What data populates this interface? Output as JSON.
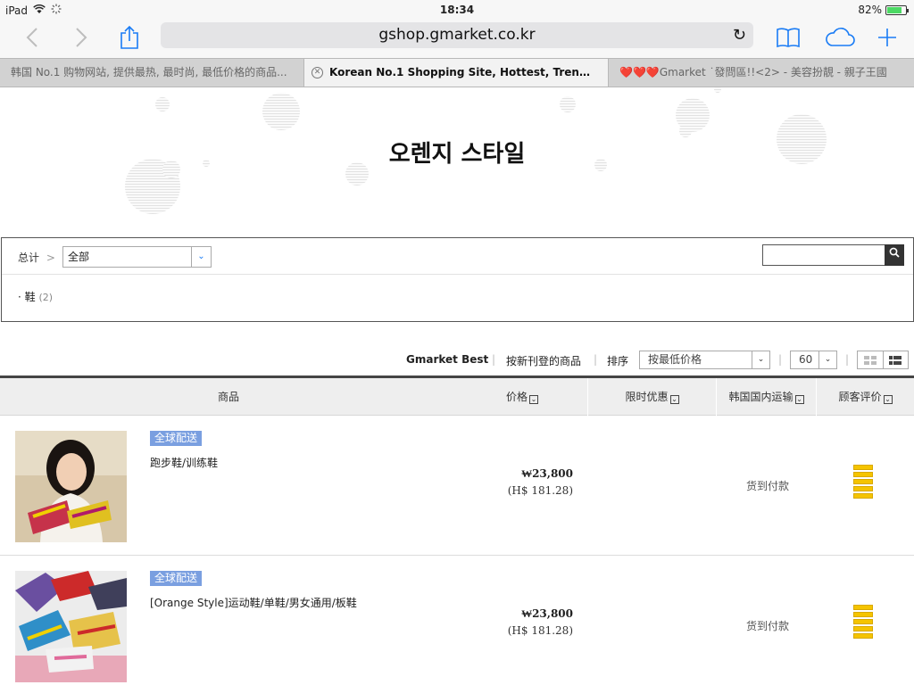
{
  "status_bar": {
    "device": "iPad",
    "time": "18:34",
    "battery": "82%",
    "battery_level": 0.82
  },
  "toolbar": {
    "url": "gshop.gmarket.co.kr",
    "icons": [
      "back-icon",
      "forward-icon",
      "share-icon",
      "reload-icon",
      "bookmarks-icon",
      "icloud-tabs-icon",
      "new-tab-icon"
    ]
  },
  "tabs": [
    {
      "label": "韩国 No.1 购物网站, 提供最热, 最时尚, 最低价格的商品...",
      "active": false
    },
    {
      "label": "Korean No.1 Shopping Site, Hottest, Trendy, Lowes...",
      "active": true
    },
    {
      "label": "❤️❤️❤️Gmarket ˙發問區!!<2> - 美容扮靚 - 親子王國",
      "active": false
    }
  ],
  "banner": {
    "title": "오렌지 스타일"
  },
  "category": {
    "crumb_label": "总计",
    "selected": "全部",
    "items": [
      {
        "label": "鞋",
        "count": "(2)"
      }
    ]
  },
  "sort": {
    "best": "Gmarket Best",
    "newest": "按新刊登的商品",
    "sort_label": "排序",
    "sort_selected": "按最低价格",
    "per_page": "60"
  },
  "table": {
    "headers": {
      "product": "商品",
      "price": "价格",
      "deal": "限时优惠",
      "shipping": "韩国国内运输",
      "rating": "顾客评价"
    },
    "rows": [
      {
        "badge": "全球配送",
        "name": "跑步鞋/训练鞋",
        "price": "₩23,800",
        "price_hk": "(H$ 181.28)",
        "shipping": "货到付款"
      },
      {
        "badge": "全球配送",
        "name": "[Orange Style]运动鞋/单鞋/男女通用/板鞋",
        "price": "₩23,800",
        "price_hk": "(H$ 181.28)",
        "shipping": "货到付款"
      }
    ]
  },
  "colors": {
    "accent": "#1a7cf5",
    "badge": "#7a9fe0",
    "rating": "#f5c400"
  }
}
